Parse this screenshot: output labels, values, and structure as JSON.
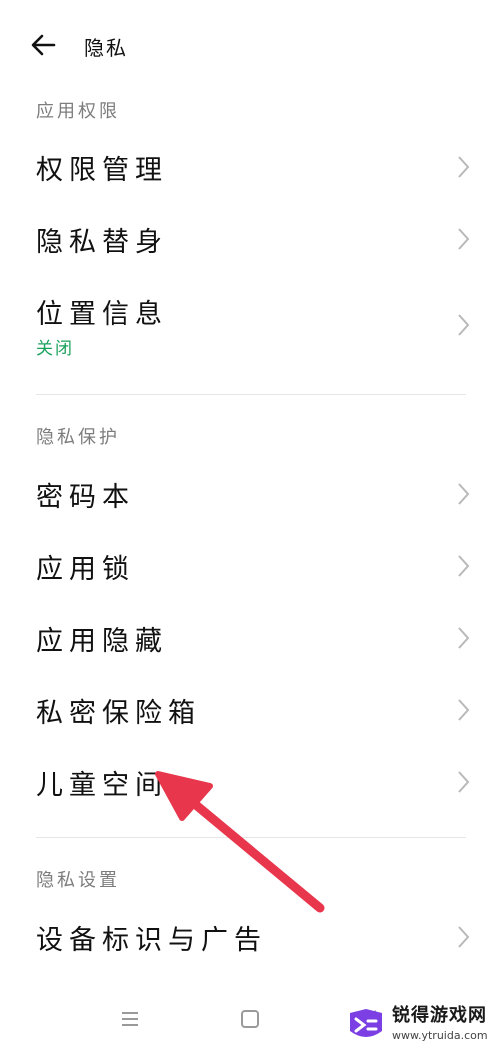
{
  "header": {
    "title": "隐私"
  },
  "sections": [
    {
      "title": "应用权限",
      "items": [
        {
          "label": "权限管理"
        },
        {
          "label": "隐私替身"
        },
        {
          "label": "位置信息",
          "sub": "关闭"
        }
      ]
    },
    {
      "title": "隐私保护",
      "items": [
        {
          "label": "密码本"
        },
        {
          "label": "应用锁"
        },
        {
          "label": "应用隐藏"
        },
        {
          "label": "私密保险箱"
        },
        {
          "label": "儿童空间"
        }
      ]
    },
    {
      "title": "隐私设置",
      "items": [
        {
          "label": "设备标识与广告"
        }
      ]
    }
  ],
  "watermark": {
    "name": "锐得游戏网",
    "url": "www.ytruida.com"
  },
  "colors": {
    "accent_green": "#1aa15b",
    "arrow_red": "#e8364c",
    "section_gray": "#7d7d7d"
  }
}
